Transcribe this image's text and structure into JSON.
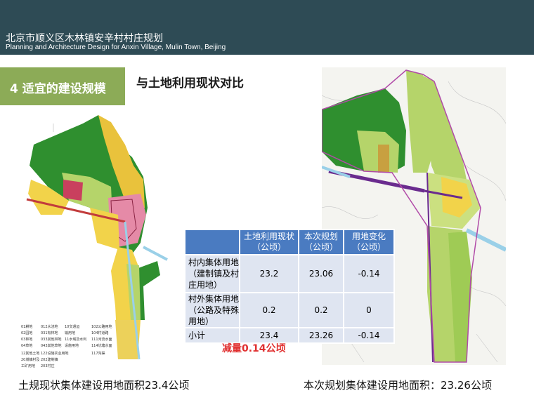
{
  "header": {
    "title_cn": "北京市顺义区木林镇安辛村村庄规划",
    "title_en": "Planning and Architecture Design for Anxin Village, Mulin Town, Beijing"
  },
  "section": {
    "label": "4  适宜的建设规模"
  },
  "heading": "与土地利用现状对比",
  "table": {
    "headers": [
      "",
      "土地利用现状\n（公顷）",
      "本次规划\n（公顷）",
      "用地变化\n（公顷）"
    ],
    "rows": [
      {
        "label": "村内集体用地（建制镇及村庄用地）",
        "current": "23.2",
        "planned": "23.06",
        "change": "-0.14"
      },
      {
        "label": "村外集体用地（公路及特殊用地）",
        "current": "0.2",
        "planned": "0.2",
        "change": "0"
      },
      {
        "label": "小计",
        "current": "23.4",
        "planned": "23.26",
        "change": "-0.14"
      }
    ]
  },
  "reduction_note": "减量0.14公顷",
  "caption_left": "土规现状集体建设用地面积23.4公顷",
  "caption_right": "本次规划集体建设用地面积：23.26公顷",
  "legend_items": [
    "01耕地",
    "012水浇地",
    "10交通运",
    "102公路用地",
    "02园地",
    "031有林地",
    "输用地",
    "104村道路",
    "03林地",
    "033其他林地",
    "11水域及水利",
    "111河流水面",
    "04草地",
    "043其他草地",
    "设施用地",
    "114坑塘水面",
    "12其他土地",
    "122设施农业用地",
    "117沟渠",
    "20城镇村及",
    "202建制镇",
    "工矿用地",
    "203村庄"
  ],
  "colors": {
    "header_bg": "#2e4b55",
    "badge_bg": "#8cab57",
    "table_header_bg": "#4a7bc1",
    "table_cell_bg": "#dfe5f1",
    "reduction_text": "#e03030",
    "map_green_dark": "#2f8f2f",
    "map_green_light": "#b5d46a",
    "map_yellow": "#f2d34a",
    "map_pink": "#e58aa7",
    "map_purple": "#6a2b8e"
  }
}
